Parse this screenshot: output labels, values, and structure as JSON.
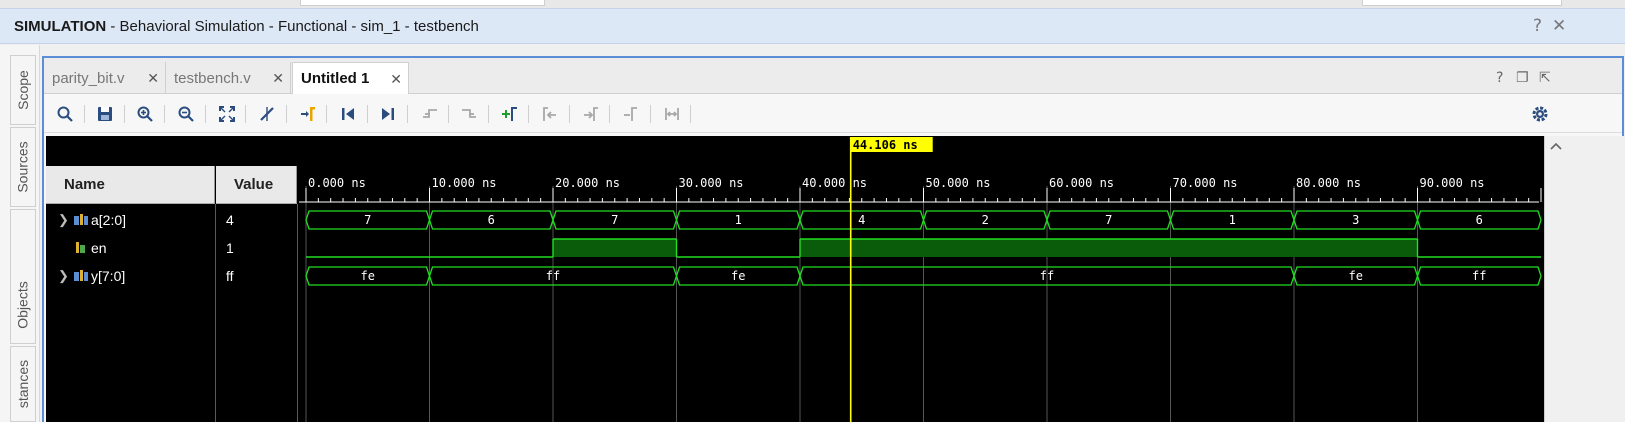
{
  "window": {
    "title_prefix": "SIMULATION",
    "title_rest": " - Behavioral Simulation - Functional - sim_1 - testbench",
    "help_btn": "?",
    "close_btn": "✕"
  },
  "sidebar": {
    "tabs": [
      "Scope",
      "Sources",
      "Objects",
      "stances"
    ]
  },
  "tabs": [
    {
      "label": "parity_bit.v",
      "active": false
    },
    {
      "label": "testbench.v",
      "active": false
    },
    {
      "label": "Untitled 1",
      "active": true
    }
  ],
  "tab_close": "✕",
  "tab_controls": {
    "help": "?",
    "restore": "❐",
    "maximize": "⇱"
  },
  "toolbar": {
    "icons": [
      "search-icon",
      "save-icon",
      "zoom-in-icon",
      "zoom-out-icon",
      "zoom-fit-icon",
      "cursor-snap-icon",
      "go-to-cursor-icon",
      "go-to-start-icon",
      "go-to-end-icon",
      "previous-transition-icon",
      "next-transition-icon",
      "add-marker-icon",
      "previous-marker-icon",
      "next-marker-icon",
      "swap-cursors-icon",
      "fix-cursor-icon",
      "settings-icon"
    ]
  },
  "waveform": {
    "columns": {
      "name": "Name",
      "value": "Value"
    },
    "cursor_time": "44.106 ns",
    "time_ticks": [
      "0.000 ns",
      "10.000 ns",
      "20.000 ns",
      "30.000 ns",
      "40.000 ns",
      "50.000 ns",
      "60.000 ns",
      "70.000 ns",
      "80.000 ns",
      "90.000 ns"
    ],
    "signals": [
      {
        "name": "a[2:0]",
        "value": "4",
        "type": "bus",
        "expandable": true,
        "segments": [
          {
            "t0": 0,
            "t1": 10,
            "label": "7"
          },
          {
            "t0": 10,
            "t1": 20,
            "label": "6"
          },
          {
            "t0": 20,
            "t1": 30,
            "label": "7"
          },
          {
            "t0": 30,
            "t1": 40,
            "label": "1"
          },
          {
            "t0": 40,
            "t1": 50,
            "label": "4"
          },
          {
            "t0": 50,
            "t1": 60,
            "label": "2"
          },
          {
            "t0": 60,
            "t1": 70,
            "label": "7"
          },
          {
            "t0": 70,
            "t1": 80,
            "label": "1"
          },
          {
            "t0": 80,
            "t1": 90,
            "label": "3"
          },
          {
            "t0": 90,
            "t1": 100,
            "label": "6"
          }
        ]
      },
      {
        "name": "en",
        "value": "1",
        "type": "bit",
        "expandable": false,
        "segments": [
          {
            "t0": 0,
            "t1": 20,
            "level": 0
          },
          {
            "t0": 20,
            "t1": 30,
            "level": 1
          },
          {
            "t0": 30,
            "t1": 40,
            "level": 0
          },
          {
            "t0": 40,
            "t1": 90,
            "level": 1
          },
          {
            "t0": 90,
            "t1": 100,
            "level": 0
          }
        ]
      },
      {
        "name": "y[7:0]",
        "value": "ff",
        "type": "bus",
        "expandable": true,
        "segments": [
          {
            "t0": 0,
            "t1": 10,
            "label": "fe"
          },
          {
            "t0": 10,
            "t1": 30,
            "label": "ff"
          },
          {
            "t0": 30,
            "t1": 40,
            "label": "fe"
          },
          {
            "t0": 40,
            "t1": 80,
            "label": "ff"
          },
          {
            "t0": 80,
            "t1": 90,
            "label": "fe"
          },
          {
            "t0": 90,
            "t1": 100,
            "label": "ff"
          }
        ]
      }
    ],
    "colors": {
      "bus": "#22dd22",
      "bit_fill": "#0a5c0a",
      "cursor": "#ffff00",
      "grid": "#555555"
    }
  }
}
